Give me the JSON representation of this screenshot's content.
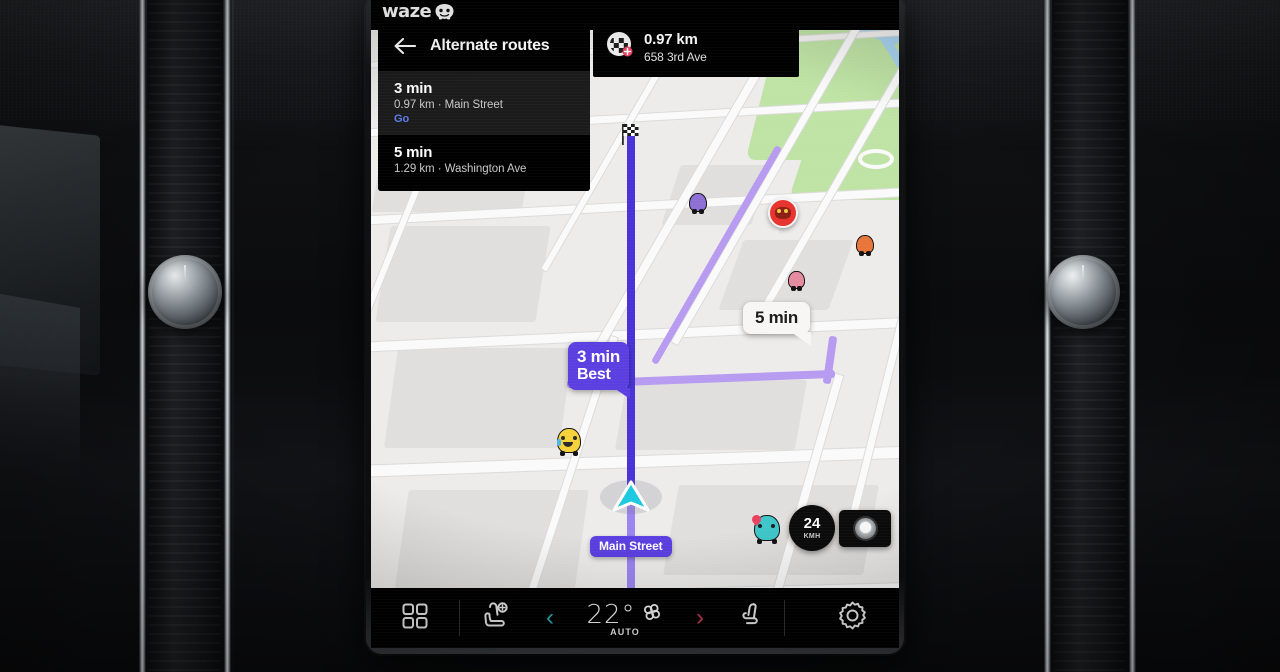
{
  "app": {
    "name": "waze",
    "logo_icon": "waze-smiley-icon"
  },
  "alternate_routes_panel": {
    "back_icon": "back-arrow-icon",
    "title": "Alternate routes",
    "routes": [
      {
        "eta": "3 min",
        "detail": "0.97 km · Main Street",
        "action": "Go",
        "selected": true
      },
      {
        "eta": "5 min",
        "detail": "1.29 km · Washington Ave",
        "action": "",
        "selected": false
      }
    ]
  },
  "destination_panel": {
    "flag_icon": "checkered-flag-icon",
    "distance": "0.97 km",
    "address": "658 3rd Ave"
  },
  "map": {
    "best_route_callout": {
      "line1": "3 min",
      "line2": "Best"
    },
    "alt_route_callout": {
      "line1": "5 min"
    },
    "street_label": "Main Street",
    "destination_flag_icon": "checkered-flag-icon",
    "vehicle_icon": "navigation-arrow-icon",
    "markers": [
      {
        "icon": "wazer-mood-purple-icon"
      },
      {
        "icon": "wazer-report-red-icon"
      },
      {
        "icon": "wazer-mood-orange-icon"
      },
      {
        "icon": "wazer-mood-pink-icon"
      },
      {
        "icon": "wazer-mood-yellow-icon"
      },
      {
        "icon": "wazer-mood-teal-icon"
      }
    ],
    "colors": {
      "route_best": "#4b32d6",
      "route_alt": "#b79bf0",
      "land": "#edeceb",
      "park": "#bfe3a5",
      "water": "#a9d4ef",
      "accent_purple": "#5b3fe0"
    }
  },
  "speedometer": {
    "value": "24",
    "unit": "KMH"
  },
  "report_button": {
    "icon": "report-button-icon",
    "label": ""
  },
  "climate_bar": {
    "apps_icon": "apps-grid-icon",
    "driver_seat_heat_icon": "seat-heater-icon",
    "decrease_icon": "chevron-left-icon",
    "temperature": "22°",
    "fan_icon": "fan-icon",
    "auto_label": "AUTO",
    "increase_icon": "chevron-right-icon",
    "passenger_seat_icon": "seat-icon",
    "settings_icon": "gear-icon",
    "colors": {
      "decrease": "#2fa8b5",
      "increase": "#c0394b"
    }
  }
}
